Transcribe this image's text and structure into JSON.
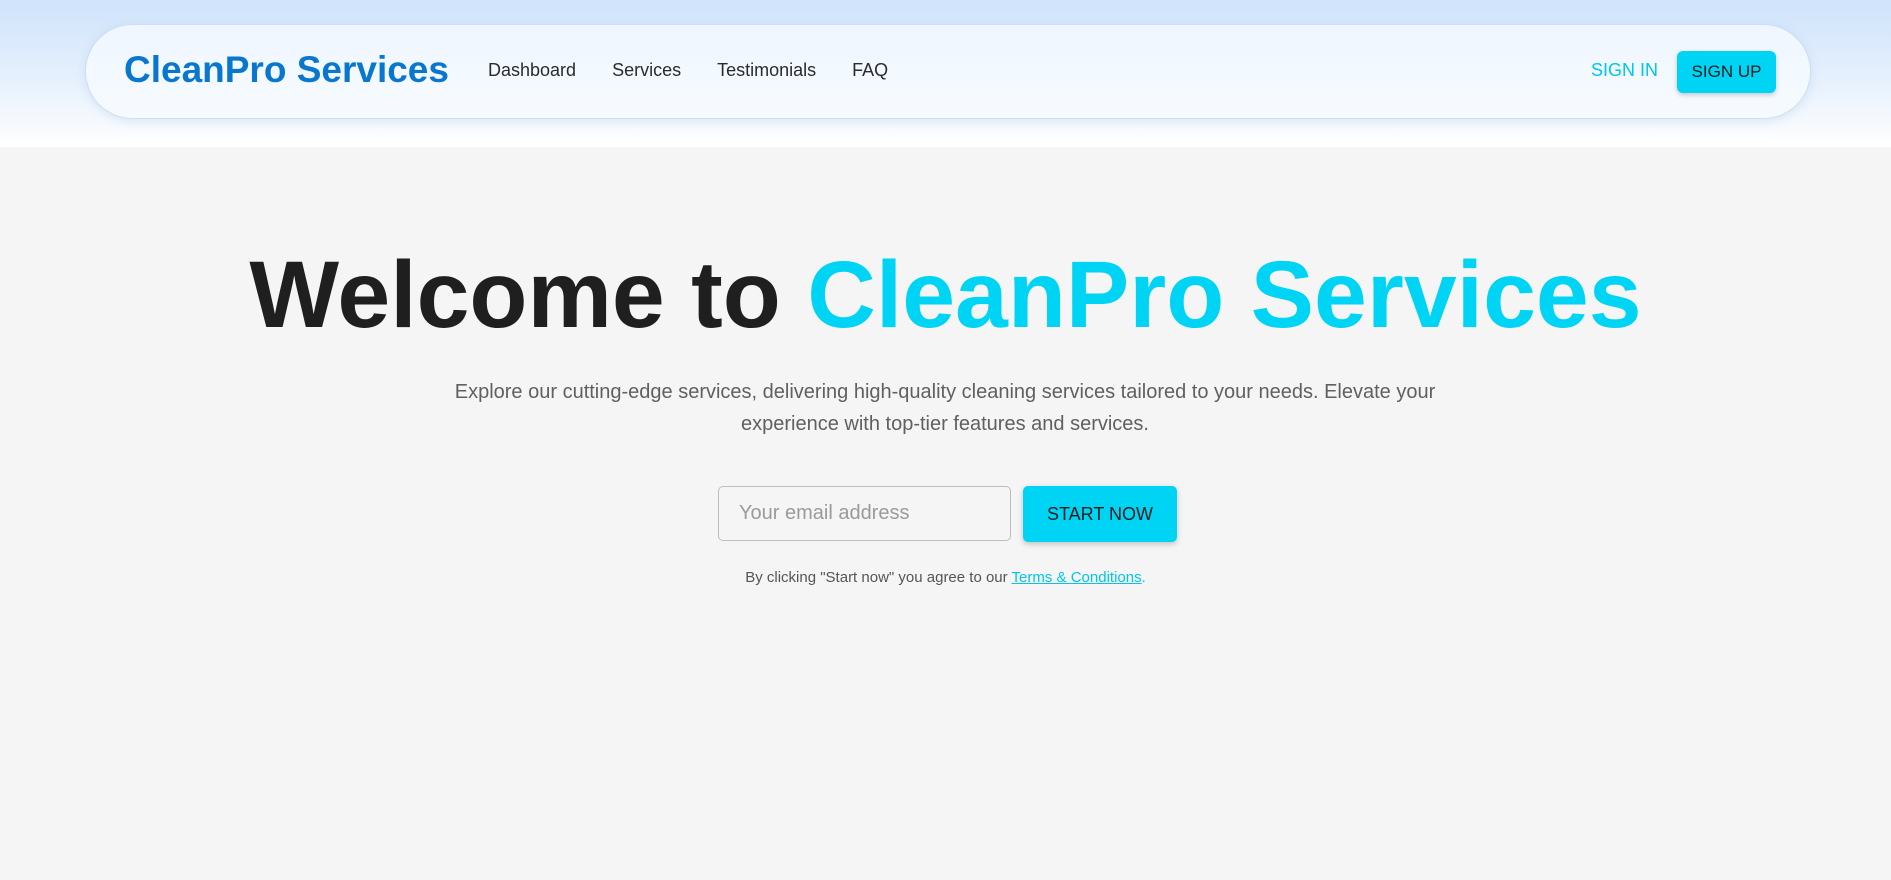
{
  "header": {
    "brand": "CleanPro Services",
    "nav": [
      {
        "label": "Dashboard"
      },
      {
        "label": "Services"
      },
      {
        "label": "Testimonials"
      },
      {
        "label": "FAQ"
      }
    ],
    "sign_in_label": "SIGN IN",
    "sign_up_label": "SIGN UP"
  },
  "hero": {
    "title_prefix": "Welcome to ",
    "title_accent": "CleanPro Services",
    "subtitle": "Explore our cutting-edge services, delivering high-quality cleaning services tailored to your needs. Elevate your experience with top-tier features and services.",
    "email_placeholder": "Your email address",
    "email_value": "",
    "cta_label": "START NOW",
    "terms_prefix": "By clicking \"Start now\" you agree to our ",
    "terms_link": "Terms & Conditions",
    "terms_suffix": "."
  },
  "colors": {
    "brand": "#0a77cf",
    "accent": "#00d4f5",
    "page_background": "#f5f5f5"
  }
}
